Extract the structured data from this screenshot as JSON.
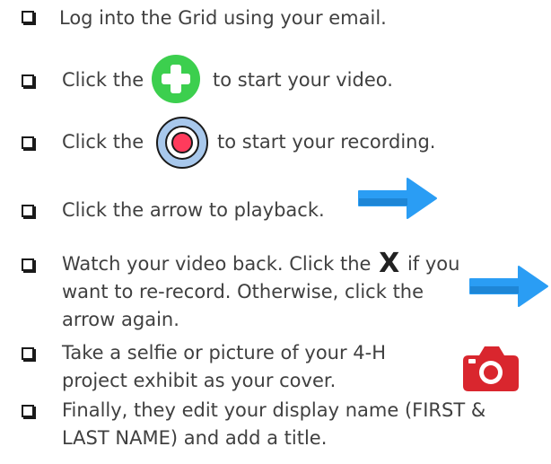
{
  "checklist": {
    "items": [
      {
        "text": "Log into the Grid using your email."
      },
      {
        "before": "Click the",
        "after": "to start your video."
      },
      {
        "before": "Click the",
        "after": "to start your recording."
      },
      {
        "text": "Click the arrow to playback."
      },
      {
        "line1_before": "Watch your video back. Click the",
        "x_label": "X",
        "line1_after": "if you",
        "line2": "want to re-record. Otherwise, click the",
        "line3": "arrow again."
      },
      {
        "line1": "Take a selfie or picture of your 4-H",
        "line2": "project exhibit as your cover."
      },
      {
        "line1": "Finally, they edit your display name (FIRST &",
        "line2": "LAST NAME) and add a title."
      }
    ]
  },
  "icons": {
    "plus_button": "plus-icon",
    "record_button": "record-icon",
    "arrow": "arrow-right-icon",
    "camera": "camera-icon"
  },
  "colors": {
    "plus_green": "#3ccf4e",
    "record_blue": "#a8c8ec",
    "record_red": "#ff3b5c",
    "arrow_blue": "#2a9df4",
    "camera_red": "#d9262e"
  }
}
